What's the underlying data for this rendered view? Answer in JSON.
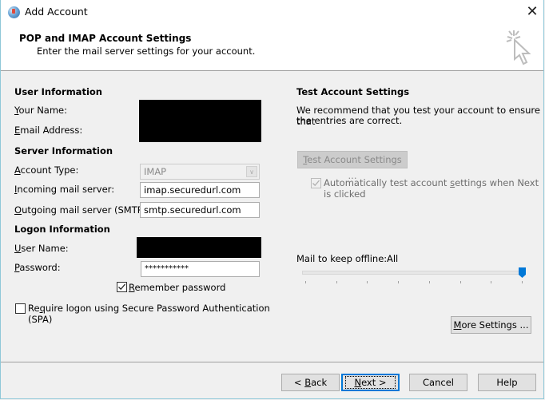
{
  "window": {
    "title": "Add Account",
    "icon": "outlook-globe-icon",
    "close_glyph": "✕"
  },
  "header": {
    "title": "POP and IMAP Account Settings",
    "subtitle": "Enter the mail server settings for your account.",
    "icon": "click-cursor-icon"
  },
  "user_info": {
    "heading": "User Information",
    "your_name": {
      "label_accel": "Y",
      "label_rest": "our Name:",
      "value": "[redacted]"
    },
    "email": {
      "label_accel": "E",
      "label_rest": "mail Address:",
      "value": "[redacted]"
    }
  },
  "server_info": {
    "heading": "Server Information",
    "account_type": {
      "label_accel": "A",
      "label_rest": "ccount Type:",
      "value": "IMAP",
      "disabled": true
    },
    "incoming": {
      "label_accel": "I",
      "label_rest": "ncoming mail server:",
      "value": "imap.securedurl.com"
    },
    "outgoing": {
      "label_accel": "O",
      "label_rest": "utgoing mail server (SMTP):",
      "value": "smtp.securedurl.com"
    }
  },
  "logon_info": {
    "heading": "Logon Information",
    "user_name": {
      "label_accel": "U",
      "label_rest": "ser Name:",
      "value": "[redacted]"
    },
    "password": {
      "label_accel": "P",
      "label_rest": "assword:",
      "value": "***********"
    },
    "remember_password": {
      "label_accel": "R",
      "label_rest": "emember password",
      "checked": true
    },
    "spa": {
      "label_pre": "Re",
      "label_accel": "q",
      "label_rest": "uire logon using Secure Password Authentication",
      "label_line2": "(SPA)",
      "checked": false
    }
  },
  "test_settings": {
    "heading": "Test Account Settings",
    "description_line1": "We recommend that you test your account to ensure that",
    "description_line2": "the entries are correct.",
    "test_button": {
      "label_accel": "T",
      "label_rest": "est Account Settings ...",
      "disabled": true
    },
    "auto_test": {
      "label_pre": "Automatically test account ",
      "label_accel": "s",
      "label_rest": "ettings when Next",
      "label_line2": "is clicked",
      "checked": true,
      "disabled": true
    }
  },
  "offline": {
    "label": "Mail to keep offline:",
    "value": "All",
    "slider_position": 1.0,
    "tick_count": 8
  },
  "more_settings": {
    "label_accel": "M",
    "label_rest": "ore Settings ..."
  },
  "footer": {
    "back": {
      "pre": "< ",
      "accel": "B",
      "rest": "ack"
    },
    "next": {
      "accel": "N",
      "rest": "ext >"
    },
    "cancel": "Cancel",
    "help": "Help"
  },
  "colors": {
    "accent": "#0078d7",
    "header_bg": "#ffffff",
    "body_bg": "#f0f0f0"
  }
}
